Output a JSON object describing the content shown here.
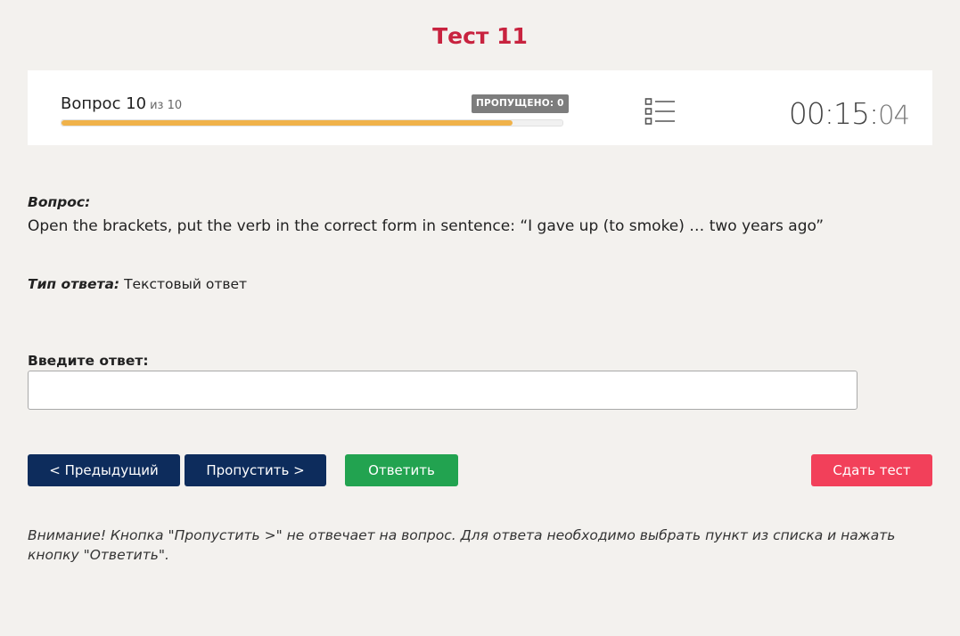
{
  "test": {
    "title": "Тест 11"
  },
  "header": {
    "question_word": "Вопрос 10",
    "of_total": "из 10",
    "skipped_badge": "ПРОПУЩЕНО: 0",
    "progress": 0.9,
    "progress_color": "#f0b24a",
    "list_icon": "list-icon",
    "timer_main": "00:15:",
    "timer_seconds": "04"
  },
  "question": {
    "label": "Вопрос:",
    "text": "Open the brackets, put the verb in the correct form in sentence: “I gave up (to smoke) … two years ago”"
  },
  "answer_type": {
    "label": "Тип ответа:",
    "value": "Текстовый ответ"
  },
  "answer_input": {
    "label": "Введите ответ:",
    "value": "",
    "placeholder": ""
  },
  "buttons": {
    "prev": "< Предыдущий",
    "skip": "Пропустить >",
    "answer": "Ответить",
    "submit": "Сдать тест"
  },
  "colors": {
    "accent": "#c8233f",
    "nav_button": "#0d2c5c",
    "answer_button": "#22a350",
    "submit_button": "#f2405a"
  },
  "warning": "Внимание! Кнопка \"Пропустить >\" не отвечает на вопрос. Для ответа необходимо выбрать пункт из списка и нажать кнопку \"Ответить\"."
}
